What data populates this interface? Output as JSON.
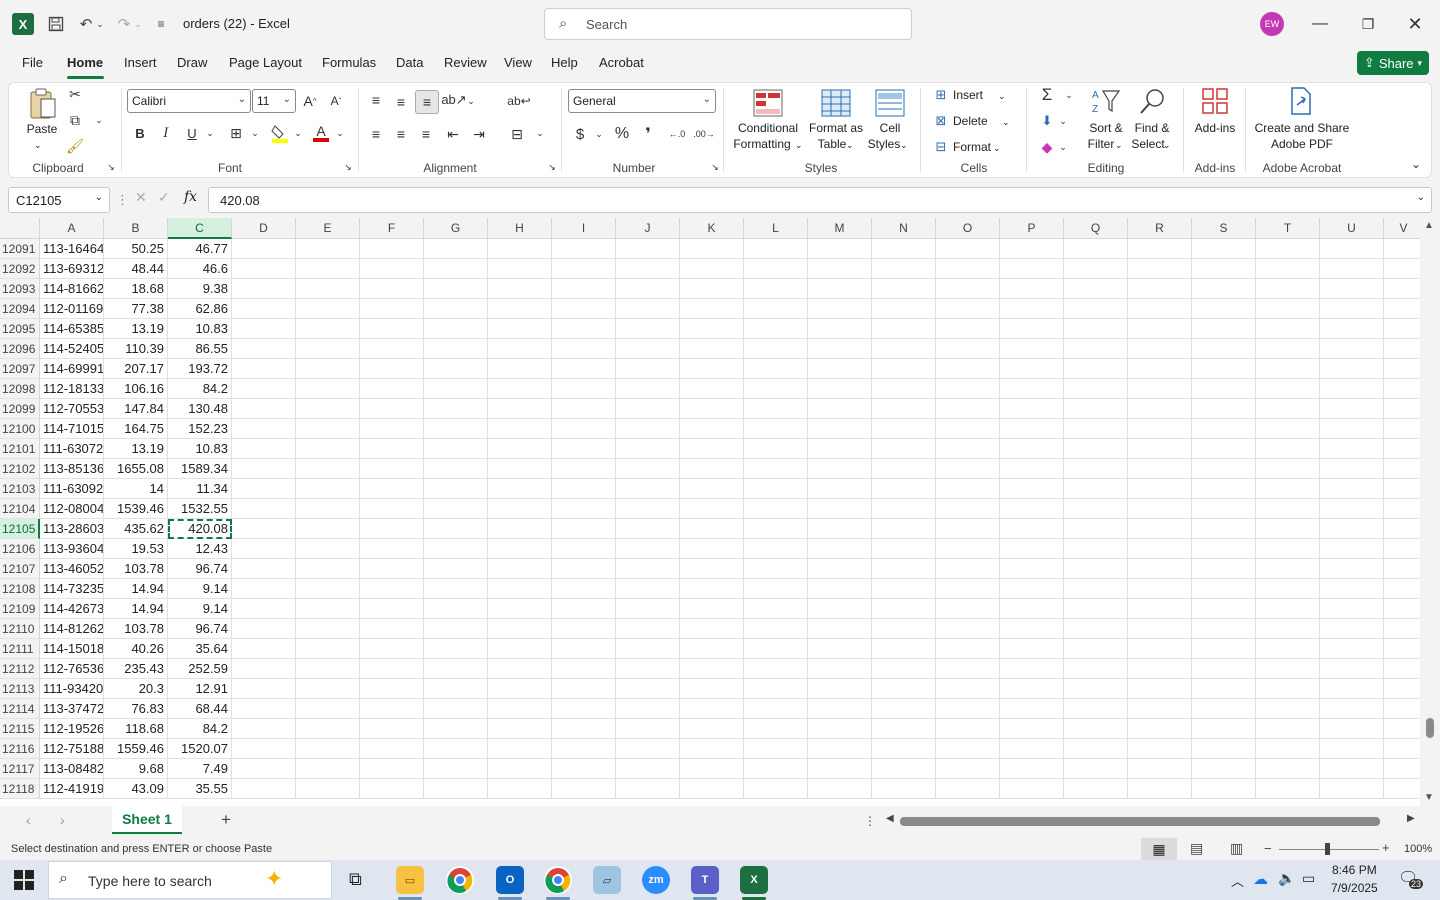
{
  "window": {
    "doc_title": "orders (22)  -  Excel",
    "search_placeholder": "Search",
    "avatar_initials": "EW"
  },
  "menu": [
    "File",
    "Home",
    "Insert",
    "Draw",
    "Page Layout",
    "Formulas",
    "Data",
    "Review",
    "View",
    "Help",
    "Acrobat"
  ],
  "active_menu": "Home",
  "share_label": "Share",
  "ribbon": {
    "clipboard": {
      "paste": "Paste",
      "group": "Clipboard"
    },
    "font": {
      "name": "Calibri",
      "size": "11",
      "group": "Font"
    },
    "alignment": {
      "group": "Alignment"
    },
    "number": {
      "format": "General",
      "group": "Number",
      "currency": "$",
      "percent": "%"
    },
    "styles": {
      "conditional": "Conditional",
      "formatting": "Formatting",
      "format_as": "Format as",
      "table": "Table",
      "cell": "Cell",
      "cell_styles": "Styles",
      "group": "Styles"
    },
    "cells": {
      "insert": "Insert",
      "delete": "Delete",
      "format": "Format",
      "group": "Cells"
    },
    "editing": {
      "sort": "Sort &",
      "filter": "Filter",
      "find": "Find &",
      "select": "Select",
      "group": "Editing"
    },
    "addins": {
      "label": "Add-ins",
      "group": "Add-ins"
    },
    "acrobat": {
      "line1": "Create and Share",
      "line2": "Adobe PDF",
      "group": "Adobe Acrobat"
    }
  },
  "formula_bar": {
    "name_box": "C12105",
    "value": "420.08",
    "fx": "fx"
  },
  "columns": [
    "A",
    "B",
    "C",
    "D",
    "E",
    "F",
    "G",
    "H",
    "I",
    "J",
    "K",
    "L",
    "M",
    "N",
    "O",
    "P",
    "Q",
    "R",
    "S",
    "T",
    "U",
    "V"
  ],
  "selected_column": "C",
  "selected_row": "12105",
  "rows": [
    {
      "n": "12091",
      "a": "113-16464",
      "b": "50.25",
      "c": "46.77"
    },
    {
      "n": "12092",
      "a": "113-69312",
      "b": "48.44",
      "c": "46.6"
    },
    {
      "n": "12093",
      "a": "114-81662",
      "b": "18.68",
      "c": "9.38"
    },
    {
      "n": "12094",
      "a": "112-01169",
      "b": "77.38",
      "c": "62.86"
    },
    {
      "n": "12095",
      "a": "114-65385",
      "b": "13.19",
      "c": "10.83"
    },
    {
      "n": "12096",
      "a": "114-52405",
      "b": "110.39",
      "c": "86.55"
    },
    {
      "n": "12097",
      "a": "114-69991",
      "b": "207.17",
      "c": "193.72"
    },
    {
      "n": "12098",
      "a": "112-18133",
      "b": "106.16",
      "c": "84.2"
    },
    {
      "n": "12099",
      "a": "112-70553",
      "b": "147.84",
      "c": "130.48"
    },
    {
      "n": "12100",
      "a": "114-71015",
      "b": "164.75",
      "c": "152.23"
    },
    {
      "n": "12101",
      "a": "111-63072",
      "b": "13.19",
      "c": "10.83"
    },
    {
      "n": "12102",
      "a": "113-85136",
      "b": "1655.08",
      "c": "1589.34"
    },
    {
      "n": "12103",
      "a": "111-63092",
      "b": "14",
      "c": "11.34"
    },
    {
      "n": "12104",
      "a": "112-08004",
      "b": "1539.46",
      "c": "1532.55"
    },
    {
      "n": "12105",
      "a": "113-28603",
      "b": "435.62",
      "c": "420.08"
    },
    {
      "n": "12106",
      "a": "113-93604",
      "b": "19.53",
      "c": "12.43"
    },
    {
      "n": "12107",
      "a": "113-46052",
      "b": "103.78",
      "c": "96.74"
    },
    {
      "n": "12108",
      "a": "114-73235",
      "b": "14.94",
      "c": "9.14"
    },
    {
      "n": "12109",
      "a": "114-42673",
      "b": "14.94",
      "c": "9.14"
    },
    {
      "n": "12110",
      "a": "114-81262",
      "b": "103.78",
      "c": "96.74"
    },
    {
      "n": "12111",
      "a": "114-15018",
      "b": "40.26",
      "c": "35.64"
    },
    {
      "n": "12112",
      "a": "112-76536",
      "b": "235.43",
      "c": "252.59"
    },
    {
      "n": "12113",
      "a": "111-93420",
      "b": "20.3",
      "c": "12.91"
    },
    {
      "n": "12114",
      "a": "113-37472",
      "b": "76.83",
      "c": "68.44"
    },
    {
      "n": "12115",
      "a": "112-19526",
      "b": "118.68",
      "c": "84.2"
    },
    {
      "n": "12116",
      "a": "112-75188",
      "b": "1559.46",
      "c": "1520.07"
    },
    {
      "n": "12117",
      "a": "113-08482",
      "b": "9.68",
      "c": "7.49"
    },
    {
      "n": "12118",
      "a": "112-41919",
      "b": "43.09",
      "c": "35.55"
    }
  ],
  "sheet_tab": "Sheet 1",
  "status": {
    "message": "Select destination and press ENTER or choose Paste",
    "zoom": "100%"
  },
  "taskbar": {
    "search_placeholder": "Type here to search",
    "time": "8:46 PM",
    "date": "7/9/2025",
    "notifications": "23"
  },
  "colors": {
    "accent": "#107c41",
    "selection_fill": "#d3f0e0"
  }
}
